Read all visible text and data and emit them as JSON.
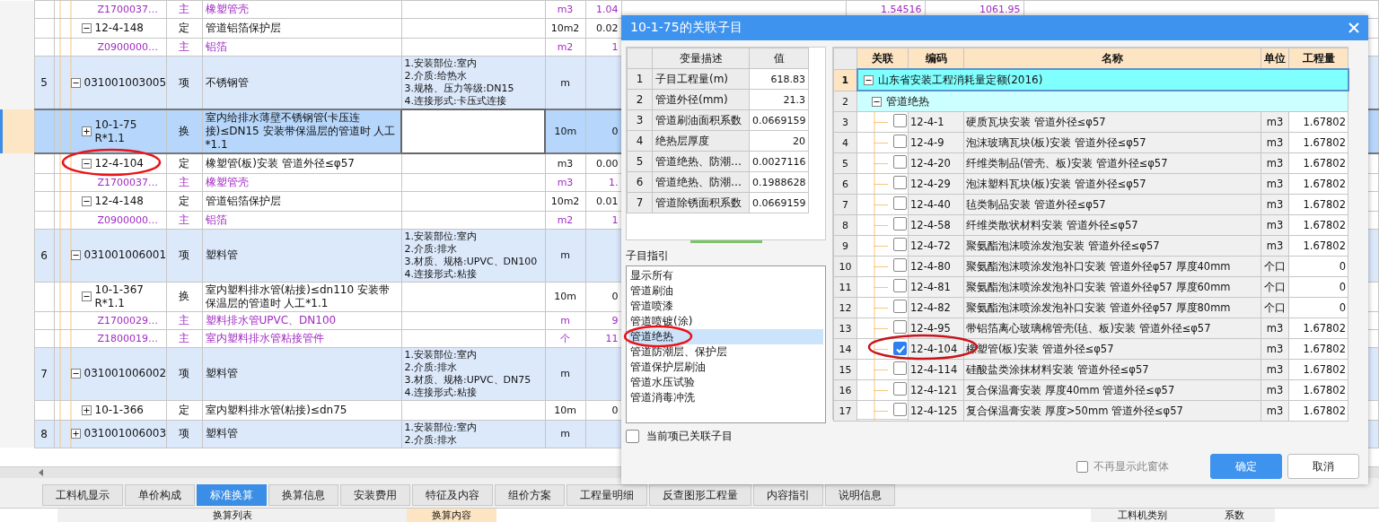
{
  "main_table": {
    "rows": [
      {
        "kind": "material",
        "code": "Z1700037…",
        "type": "主",
        "name": "橡塑管壳",
        "unit": "m3",
        "quantity": "1.04",
        "column_10": "1.54516",
        "column_11": "1061.95",
        "selected": false
      },
      {
        "kind": "quota",
        "code": "12-4-148",
        "type": "定",
        "name": "管道铝箔保护层",
        "unit": "10m2",
        "quantity": "0.02",
        "expanded": true,
        "selected": false,
        "children": [
          {
            "kind": "material",
            "code": "Z0900000…",
            "type": "主",
            "name": "铝箔",
            "unit": "m2",
            "quantity": "1",
            "selected": false
          }
        ]
      },
      {
        "kind": "item",
        "no": "5",
        "code": "031001003005",
        "type": "项",
        "name": "不锈钢管",
        "features": [
          "1.安装部位:室内",
          "2.介质:给热水",
          "3.规格、压力等级:DN15",
          "4.连接形式:卡压式连接"
        ],
        "unit": "m",
        "expanded": true,
        "selected": false,
        "children": [
          {
            "kind": "quota",
            "code": "10-1-75",
            "modifier": "R*1.1",
            "type": "换",
            "name": "室内给排水薄壁不锈钢管(卡压连接)≤DN15  安装带保温层的管道时 人工*1.1",
            "unit": "10m",
            "quantity": "0",
            "expanded": false,
            "selected": true
          },
          {
            "kind": "quota",
            "code": "12-4-104",
            "type": "定",
            "name": "橡塑管(板)安装 管道外径≤φ57",
            "unit": "m3",
            "quantity": "0.00",
            "expanded": true,
            "selected": false,
            "children": [
              {
                "kind": "material",
                "code": "Z1700037…",
                "type": "主",
                "name": "橡塑管壳",
                "unit": "m3",
                "quantity": "1.",
                "selected": false
              }
            ]
          },
          {
            "kind": "quota",
            "code": "12-4-148",
            "type": "定",
            "name": "管道铝箔保护层",
            "unit": "10m2",
            "quantity": "0.01",
            "expanded": true,
            "selected": false,
            "children": [
              {
                "kind": "material",
                "code": "Z0900000…",
                "type": "主",
                "name": "铝箔",
                "unit": "m2",
                "quantity": "1",
                "selected": false
              }
            ]
          }
        ]
      },
      {
        "kind": "item",
        "no": "6",
        "code": "031001006001",
        "type": "项",
        "name": "塑料管",
        "features": [
          "1.安装部位:室内",
          "2.介质:排水",
          "3.材质、规格:UPVC、DN100",
          "4.连接形式:粘接"
        ],
        "unit": "m",
        "expanded": true,
        "selected": false,
        "children": [
          {
            "kind": "quota",
            "code": "10-1-367",
            "modifier": "R*1.1",
            "type": "换",
            "name": "室内塑料排水管(粘接)≤dn110  安装带保温层的管道时 人工*1.1",
            "unit": "10m",
            "quantity": "0",
            "expanded": true,
            "selected": false,
            "children": [
              {
                "kind": "material",
                "code": "Z1700029…",
                "type": "主",
                "name": "塑料排水管UPVC、DN100",
                "unit": "m",
                "quantity": "9",
                "selected": false
              },
              {
                "kind": "material",
                "code": "Z1800019…",
                "type": "主",
                "name": "室内塑料排水管粘接管件",
                "unit": "个",
                "quantity": "11",
                "selected": false
              }
            ]
          }
        ]
      },
      {
        "kind": "item",
        "no": "7",
        "code": "031001006002",
        "type": "项",
        "name": "塑料管",
        "features": [
          "1.安装部位:室内",
          "2.介质:排水",
          "3.材质、规格:UPVC、DN75",
          "4.连接形式:粘接"
        ],
        "unit": "m",
        "expanded": true,
        "selected": false,
        "children": [
          {
            "kind": "quota",
            "code": "10-1-366",
            "type": "定",
            "name": "室内塑料排水管(粘接)≤dn75",
            "unit": "10m",
            "quantity": "0",
            "expanded": false,
            "selected": false
          }
        ]
      },
      {
        "kind": "item",
        "no": "8",
        "code": "031001006003",
        "type": "项",
        "name": "塑料管",
        "features": [
          "1.安装部位:室内",
          "2.介质:排水"
        ],
        "unit": "m",
        "expanded": false,
        "selected": false
      }
    ]
  },
  "bottom_tabs": [
    {
      "label": "工料机显示",
      "selected": false
    },
    {
      "label": "单价构成",
      "selected": false
    },
    {
      "label": "标准换算",
      "selected": true
    },
    {
      "label": "换算信息",
      "selected": false
    },
    {
      "label": "安装费用",
      "selected": false
    },
    {
      "label": "特征及内容",
      "selected": false
    },
    {
      "label": "组价方案",
      "selected": false
    },
    {
      "label": "工程量明细",
      "selected": false
    },
    {
      "label": "反查图形工程量",
      "selected": false
    },
    {
      "label": "内容指引",
      "selected": false
    },
    {
      "label": "说明信息",
      "selected": false
    }
  ],
  "bottom_panel": {
    "columns": [
      {
        "label": "换算列表",
        "selected": false
      },
      {
        "label": "换算内容",
        "selected": true
      },
      {
        "label": "工料机类别",
        "selected": false
      },
      {
        "label": "系数",
        "selected": false
      }
    ]
  },
  "dialog": {
    "title": "10-1-75的关联子目",
    "variables": {
      "columns": [
        "变量描述",
        "值"
      ],
      "rows": [
        {
          "no": "1",
          "description": "子目工程量(m)",
          "value": "618.83"
        },
        {
          "no": "2",
          "description": "管道外径(mm)",
          "value": "21.3"
        },
        {
          "no": "3",
          "description": "管道刷油面积系数",
          "value": "0.0669159"
        },
        {
          "no": "4",
          "description": "绝热层厚度",
          "value": "20"
        },
        {
          "no": "5",
          "description": "管道绝热、防潮…",
          "value": "0.0027116"
        },
        {
          "no": "6",
          "description": "管道绝热、防潮…",
          "value": "0.1988628"
        },
        {
          "no": "7",
          "description": "管道除锈面积系数",
          "value": "0.0669159"
        }
      ]
    },
    "guide": {
      "label": "子目指引",
      "items": [
        {
          "label": "显示所有",
          "selected": false
        },
        {
          "label": "管道刷油",
          "selected": false
        },
        {
          "label": "管道喷漆",
          "selected": false
        },
        {
          "label": "管道喷镀(涂)",
          "selected": false
        },
        {
          "label": "管道绝热",
          "selected": true
        },
        {
          "label": "管道防潮层、保护层",
          "selected": false
        },
        {
          "label": "管道保护层刷油",
          "selected": false
        },
        {
          "label": "管道水压试验",
          "selected": false
        },
        {
          "label": "管道消毒冲洗",
          "selected": false
        }
      ]
    },
    "linked_only": {
      "label": "当前项已关联子目",
      "checked": false
    },
    "grid": {
      "columns": [
        "关联",
        "编码",
        "名称",
        "单位",
        "工程量"
      ],
      "rows": [
        {
          "kind": "group",
          "no": "1",
          "name": "山东省安装工程消耗量定额(2016)",
          "expanded": true,
          "selected": true,
          "children": [
            {
              "kind": "group",
              "no": "2",
              "name": "管道绝热",
              "expanded": true,
              "selected": false,
              "children": [
                {
                  "kind": "entry",
                  "no": "3",
                  "code": "12-4-1",
                  "name": "硬质瓦块安装 管道外径≤φ57",
                  "unit": "m3",
                  "quantity": "1.67802",
                  "linked": false,
                  "selected": false
                },
                {
                  "kind": "entry",
                  "no": "4",
                  "code": "12-4-9",
                  "name": "泡沫玻璃瓦块(板)安装 管道外径≤φ57",
                  "unit": "m3",
                  "quantity": "1.67802",
                  "linked": false,
                  "selected": false
                },
                {
                  "kind": "entry",
                  "no": "5",
                  "code": "12-4-20",
                  "name": "纤维类制品(管壳、板)安装 管道外径≤φ57",
                  "unit": "m3",
                  "quantity": "1.67802",
                  "linked": false,
                  "selected": false
                },
                {
                  "kind": "entry",
                  "no": "6",
                  "code": "12-4-29",
                  "name": "泡沫塑料瓦块(板)安装 管道外径≤φ57",
                  "unit": "m3",
                  "quantity": "1.67802",
                  "linked": false,
                  "selected": false
                },
                {
                  "kind": "entry",
                  "no": "7",
                  "code": "12-4-40",
                  "name": "毡类制品安装 管道外径≤φ57",
                  "unit": "m3",
                  "quantity": "1.67802",
                  "linked": false,
                  "selected": false
                },
                {
                  "kind": "entry",
                  "no": "8",
                  "code": "12-4-58",
                  "name": "纤维类散状材料安装 管道外径≤φ57",
                  "unit": "m3",
                  "quantity": "1.67802",
                  "linked": false,
                  "selected": false
                },
                {
                  "kind": "entry",
                  "no": "9",
                  "code": "12-4-72",
                  "name": "聚氨酯泡沫喷涂发泡安装 管道外径≤φ57",
                  "unit": "m3",
                  "quantity": "1.67802",
                  "linked": false,
                  "selected": false
                },
                {
                  "kind": "entry",
                  "no": "10",
                  "code": "12-4-80",
                  "name": "聚氨酯泡沫喷涂发泡补口安装 管道外径φ57 厚度40mm",
                  "unit": "个口",
                  "quantity": "0",
                  "linked": false,
                  "selected": false
                },
                {
                  "kind": "entry",
                  "no": "11",
                  "code": "12-4-81",
                  "name": "聚氨酯泡沫喷涂发泡补口安装 管道外径φ57 厚度60mm",
                  "unit": "个口",
                  "quantity": "0",
                  "linked": false,
                  "selected": false
                },
                {
                  "kind": "entry",
                  "no": "12",
                  "code": "12-4-82",
                  "name": "聚氨酯泡沫喷涂发泡补口安装 管道外径φ57 厚度80mm",
                  "unit": "个口",
                  "quantity": "0",
                  "linked": false,
                  "selected": false
                },
                {
                  "kind": "entry",
                  "no": "13",
                  "code": "12-4-95",
                  "name": "带铝箔离心玻璃棉管壳(毡、板)安装 管道外径≤φ57",
                  "unit": "m3",
                  "quantity": "1.67802",
                  "linked": false,
                  "selected": false
                },
                {
                  "kind": "entry",
                  "no": "14",
                  "code": "12-4-104",
                  "name": "橡塑管(板)安装 管道外径≤φ57",
                  "unit": "m3",
                  "quantity": "1.67802",
                  "linked": true,
                  "selected": false
                },
                {
                  "kind": "entry",
                  "no": "15",
                  "code": "12-4-114",
                  "name": "硅酸盐类涂抹材料安装 管道外径≤φ57",
                  "unit": "m3",
                  "quantity": "1.67802",
                  "linked": false,
                  "selected": false
                },
                {
                  "kind": "entry",
                  "no": "16",
                  "code": "12-4-121",
                  "name": "复合保温膏安装 厚度40mm 管道外径≤φ57",
                  "unit": "m3",
                  "quantity": "1.67802",
                  "linked": false,
                  "selected": false
                },
                {
                  "kind": "entry",
                  "no": "17",
                  "code": "12-4-125",
                  "name": "复合保温膏安装 厚度>50mm 管道外径≤φ57",
                  "unit": "m3",
                  "quantity": "1.67802",
                  "linked": false,
                  "selected": false
                }
              ]
            }
          ]
        }
      ]
    },
    "dont_show_again": {
      "label": "不再显示此窗体",
      "checked": false
    },
    "buttons": [
      {
        "label": "确定",
        "kind": "primary"
      },
      {
        "label": "取消",
        "kind": "secondary"
      }
    ]
  }
}
